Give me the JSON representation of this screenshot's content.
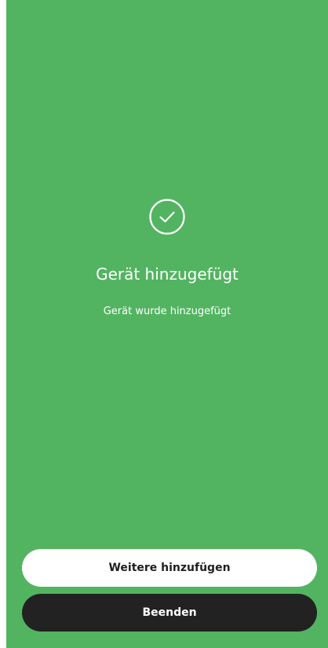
{
  "screen": {
    "title": "Gerät hinzugefügt",
    "message": "Gerät wurde hinzugefügt",
    "icon": "check-circle-icon"
  },
  "actions": {
    "add_more_label": "Weitere hinzufügen",
    "finish_label": "Beenden"
  },
  "colors": {
    "background": "#52b461",
    "primary_button": "#222222",
    "secondary_button": "#ffffff",
    "text_light": "#ffffff"
  }
}
